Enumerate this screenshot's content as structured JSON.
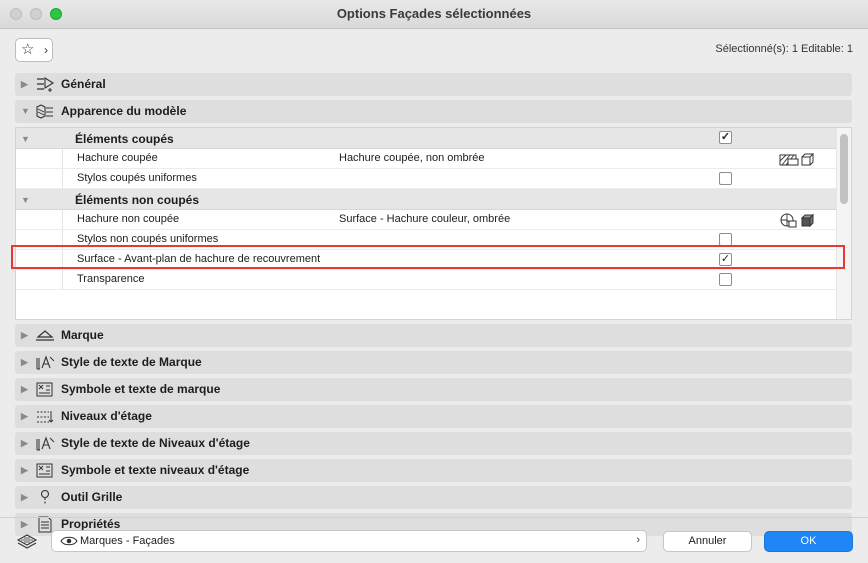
{
  "window": {
    "title": "Options Façades sélectionnées"
  },
  "toolbar": {
    "favorites_star": "☆",
    "favorites_chevron": "›",
    "selection_info": "Sélectionné(s): 1 Editable: 1"
  },
  "sections_top": [
    {
      "label": "Général",
      "icon": "general-settings-icon",
      "expanded": false
    },
    {
      "label": "Apparence du modèle",
      "icon": "model-appearance-icon",
      "expanded": true
    }
  ],
  "model_appearance": {
    "groups": [
      {
        "label": "Éléments coupés",
        "checked": true,
        "rows": [
          {
            "label": "Hachure coupée",
            "value": "Hachure coupée, non ombrée",
            "checkbox": null,
            "icons": [
              "hatch-options-icon",
              "3d-box-outline-icon"
            ]
          },
          {
            "label": "Stylos coupés uniformes",
            "value": "",
            "checkbox": false,
            "icons": []
          }
        ]
      },
      {
        "label": "Éléments non coupés",
        "checked": null,
        "rows": [
          {
            "label": "Hachure non coupée",
            "value": "Surface - Hachure couleur, ombrée",
            "checkbox": null,
            "icons": [
              "sun-shading-icon",
              "3d-box-solid-icon"
            ]
          },
          {
            "label": "Stylos non coupés uniformes",
            "value": "",
            "checkbox": false,
            "icons": []
          },
          {
            "label": "Surface - Avant-plan de hachure de recouvrement",
            "value": "",
            "checkbox": true,
            "icons": []
          },
          {
            "label": "Transparence",
            "value": "",
            "checkbox": false,
            "icons": []
          }
        ]
      }
    ]
  },
  "sections_bottom": [
    {
      "label": "Marque",
      "icon": "marker-icon"
    },
    {
      "label": "Style de texte de Marque",
      "icon": "text-style-icon"
    },
    {
      "label": "Symbole et texte de marque",
      "icon": "symbol-text-icon"
    },
    {
      "label": "Niveaux d'étage",
      "icon": "story-levels-icon"
    },
    {
      "label": "Style de texte de Niveaux d'étage",
      "icon": "text-style-icon"
    },
    {
      "label": "Symbole et texte niveaux d'étage",
      "icon": "symbol-text-icon"
    },
    {
      "label": "Outil Grille",
      "icon": "grid-tool-icon"
    },
    {
      "label": "Propriétés",
      "icon": "properties-icon"
    }
  ],
  "footer": {
    "view_selector": "Marques - Façades",
    "view_arrow": "›",
    "cancel_label": "Annuler",
    "ok_label": "OK"
  },
  "colors": {
    "accent": "#1f86f5",
    "highlight": "#e8382f",
    "section_bg": "#dedede"
  }
}
